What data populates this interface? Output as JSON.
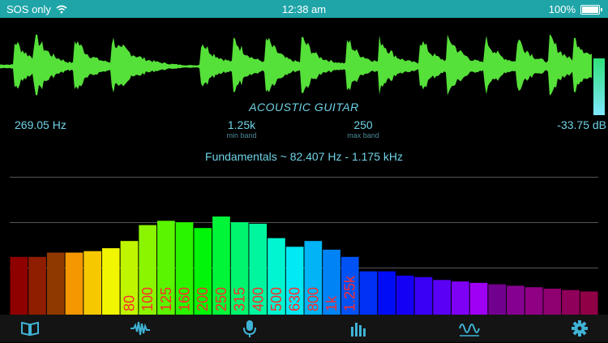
{
  "status": {
    "carrier": "SOS only",
    "time": "12:38 am",
    "battery": "100%",
    "battery_level": 1.0
  },
  "analyzer": {
    "instrument": "ACOUSTIC GUITAR",
    "peak_frequency": "269.05 Hz",
    "min_band_value": "1.25k",
    "min_band_caption": "min band",
    "max_band_value": "250",
    "max_band_caption": "max band",
    "level": "-33.75 dB",
    "fundamentals": "Fundamentals  ~  82.407 Hz  -  1.175 kHz"
  },
  "spectrum": {
    "levels": [
      0.4,
      0.4,
      0.43,
      0.43,
      0.44,
      0.46,
      0.51,
      0.62,
      0.65,
      0.64,
      0.6,
      0.68,
      0.64,
      0.63,
      0.53,
      0.47,
      0.51,
      0.45,
      0.4,
      0.3,
      0.3,
      0.27,
      0.26,
      0.24,
      0.23,
      0.22,
      0.21,
      0.2,
      0.19,
      0.18,
      0.17,
      0.16
    ],
    "band_labels": [
      "",
      "",
      "",
      "",
      "",
      "",
      "80",
      "100",
      "125",
      "160",
      "200",
      "250",
      "315",
      "400",
      "500",
      "630",
      "800",
      "1k",
      "1.25k",
      "",
      "",
      "",
      "",
      "",
      "",
      "",
      "",
      "",
      "",
      "",
      "",
      ""
    ],
    "label_color": "#ff2b2b"
  },
  "tabs": [
    {
      "icon": "book-icon",
      "active": false
    },
    {
      "icon": "waveform-icon",
      "active": false
    },
    {
      "icon": "microphone-icon",
      "active": false
    },
    {
      "icon": "spectrum-bars-icon",
      "active": true
    },
    {
      "icon": "oscilloscope-icon",
      "active": false
    },
    {
      "icon": "gear-icon",
      "active": false
    }
  ]
}
